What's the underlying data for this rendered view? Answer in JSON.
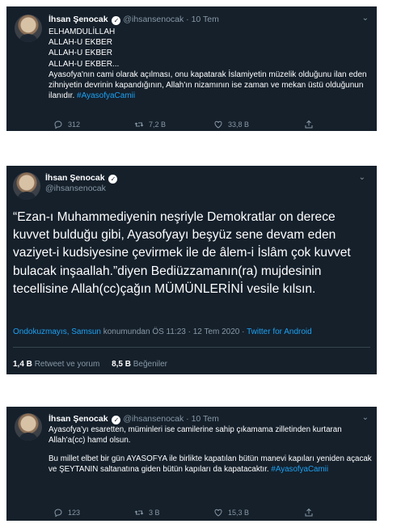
{
  "tweet1": {
    "name": "İhsan Şenocak",
    "handle": "@ihsansenocak",
    "date": "10 Tem",
    "lines": [
      "ELHAMDULİLLAH",
      "ALLAH-U EKBER",
      "ALLAH-U EKBER",
      "ALLAH-U EKBER..."
    ],
    "text": "Ayasofya'nın cami olarak açılması, onu kapatarak İslamiyetin müzelik olduğunu ilan eden zihniyetin devrinin kapandığının, Allah'ın nizamının ise zaman ve mekan üstü olduğunun ilanıdır.",
    "hashtag": "#AyasofyaCamii",
    "replies": "312",
    "retweets": "7,2 B",
    "likes": "33,8 B"
  },
  "tweet2": {
    "name": "İhsan Şenocak",
    "handle": "@ihsansenocak",
    "text": "“Ezan-ı Muhammediyenin neşriyle Demokratlar on derece kuvvet bulduğu gibi, Ayasofyayı beşyüz sene devam eden vaziyet-i kudsiyesine çevirmek ile de âlem-i İslâm çok kuvvet  bulacak inşaallah.”diyen Bediüzzamanın(ra) mujdesinin tecellisine Allah(cc)çağın MÜMÜNLERİNİ vesile kılsın.",
    "location": "Ondokuzmayıs, Samsun",
    "location_suffix": "konumundan",
    "datetime": "ÖS 11:23 · 12 Tem 2020",
    "source": "Twitter for Android",
    "retweet_count": "1,4 B",
    "retweet_label": "Retweet ve yorum",
    "like_count": "8,5 B",
    "like_label": "Beğeniler"
  },
  "tweet3": {
    "name": "İhsan Şenocak",
    "handle": "@ihsansenocak",
    "date": "10 Tem",
    "para1": "Ayasofya'yı esaretten, müminleri ise camilerine sahip çıkamama zilletinden kurtaran Allah'a(cc) hamd olsun.",
    "para2": "Bu millet elbet bir gün AYASOFYA ile birlikte kapatılan bütün manevi kapıları yeniden açacak ve ŞEYTANIN saltanatına giden bütün kapıları da kapatacaktır.",
    "hashtag": "#AyasofyaCamii",
    "replies": "123",
    "retweets": "3 B",
    "likes": "15,3 B"
  },
  "colors": {
    "background": "#15202b",
    "text": "#ffffff",
    "muted": "#8899a6",
    "link": "#1da1f2"
  },
  "icons": [
    "reply-icon",
    "retweet-icon",
    "like-icon",
    "share-icon",
    "verified-icon",
    "chevron-down-icon"
  ]
}
